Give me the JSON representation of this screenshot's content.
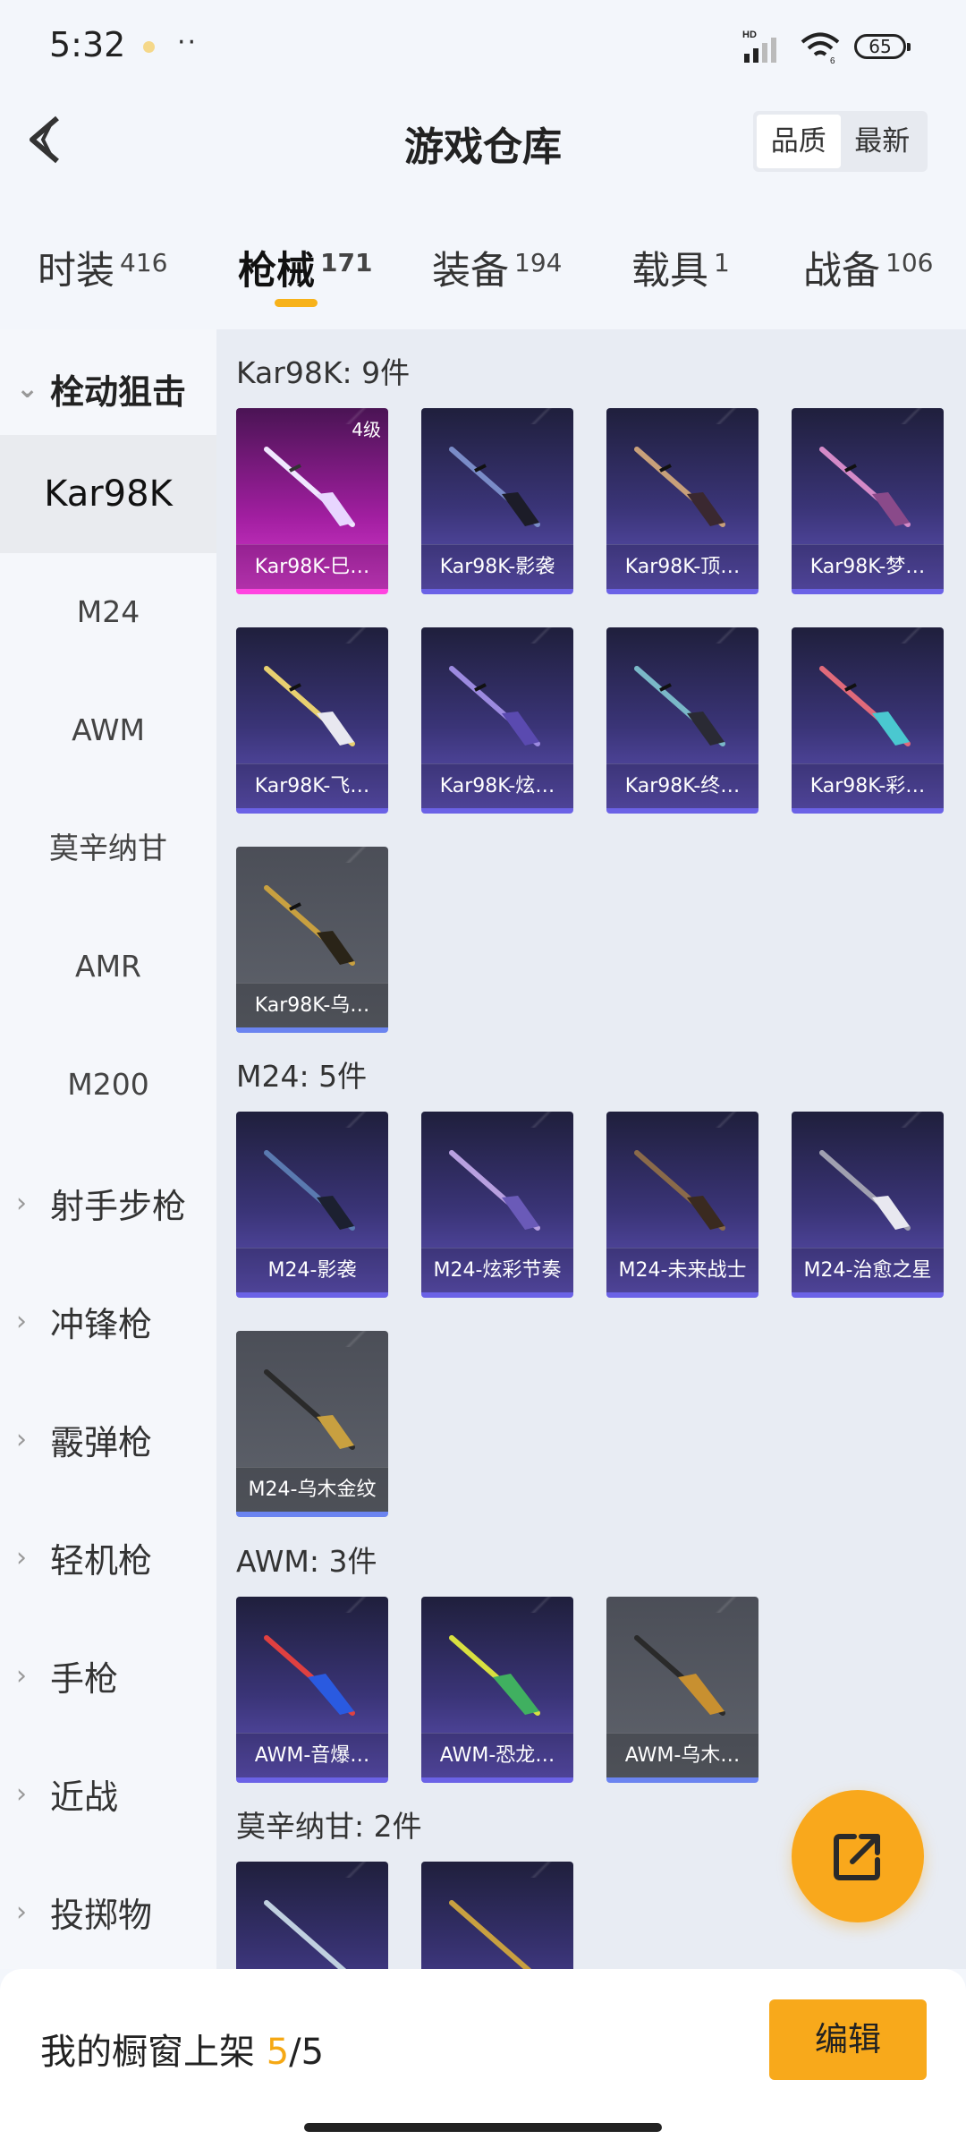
{
  "status": {
    "time": "5:32",
    "dots": "··",
    "battery": "65"
  },
  "header": {
    "title": "游戏仓库",
    "sort_options": [
      "品质",
      "最新"
    ]
  },
  "tabs": [
    {
      "label": "时装",
      "count": "416"
    },
    {
      "label": "枪械",
      "count": "171"
    },
    {
      "label": "装备",
      "count": "194"
    },
    {
      "label": "载具",
      "count": "1"
    },
    {
      "label": "战备",
      "count": "106"
    }
  ],
  "sidebar": {
    "group_open": "栓动狙击",
    "sub_items": [
      "Kar98K",
      "M24",
      "AWM",
      "莫辛纳甘",
      "AMR",
      "M200"
    ],
    "groups": [
      "射手步枪",
      "冲锋枪",
      "霰弹枪",
      "轻机枪",
      "手枪",
      "近战",
      "投掷物"
    ]
  },
  "sections": [
    {
      "title": "Kar98K: 9件",
      "items": [
        {
          "label": "Kar98K-巳…",
          "rarity": "pink",
          "level": "4级"
        },
        {
          "label": "Kar98K-影袭",
          "rarity": "purple"
        },
        {
          "label": "Kar98K-顶…",
          "rarity": "purple"
        },
        {
          "label": "Kar98K-梦…",
          "rarity": "purple"
        },
        {
          "label": "Kar98K-飞…",
          "rarity": "purple"
        },
        {
          "label": "Kar98K-炫…",
          "rarity": "purple"
        },
        {
          "label": "Kar98K-终…",
          "rarity": "purple"
        },
        {
          "label": "Kar98K-彩…",
          "rarity": "purple"
        },
        {
          "label": "Kar98K-乌…",
          "rarity": "gray"
        }
      ]
    },
    {
      "title": "M24: 5件",
      "items": [
        {
          "label": "M24-影袭",
          "rarity": "purple"
        },
        {
          "label": "M24-炫彩节奏",
          "rarity": "purple"
        },
        {
          "label": "M24-未来战士",
          "rarity": "purple"
        },
        {
          "label": "M24-治愈之星",
          "rarity": "purple"
        },
        {
          "label": "M24-乌木金纹",
          "rarity": "gray"
        }
      ]
    },
    {
      "title": "AWM: 3件",
      "items": [
        {
          "label": "AWM-音爆…",
          "rarity": "purple"
        },
        {
          "label": "AWM-恐龙…",
          "rarity": "purple"
        },
        {
          "label": "AWM-乌木…",
          "rarity": "gray"
        }
      ]
    },
    {
      "title": "莫辛纳甘: 2件",
      "items": [
        {
          "label": "",
          "rarity": "purple"
        },
        {
          "label": "",
          "rarity": "purple"
        }
      ]
    }
  ],
  "bottom": {
    "showcase_label": "我的橱窗上架",
    "used": "5",
    "total": "/5",
    "edit_label": "编辑"
  },
  "colors": {
    "accent": "#f8a91b",
    "purple_card": "#3a3477",
    "pink_card": "#a11ea0",
    "gray_card": "#5f636c"
  }
}
